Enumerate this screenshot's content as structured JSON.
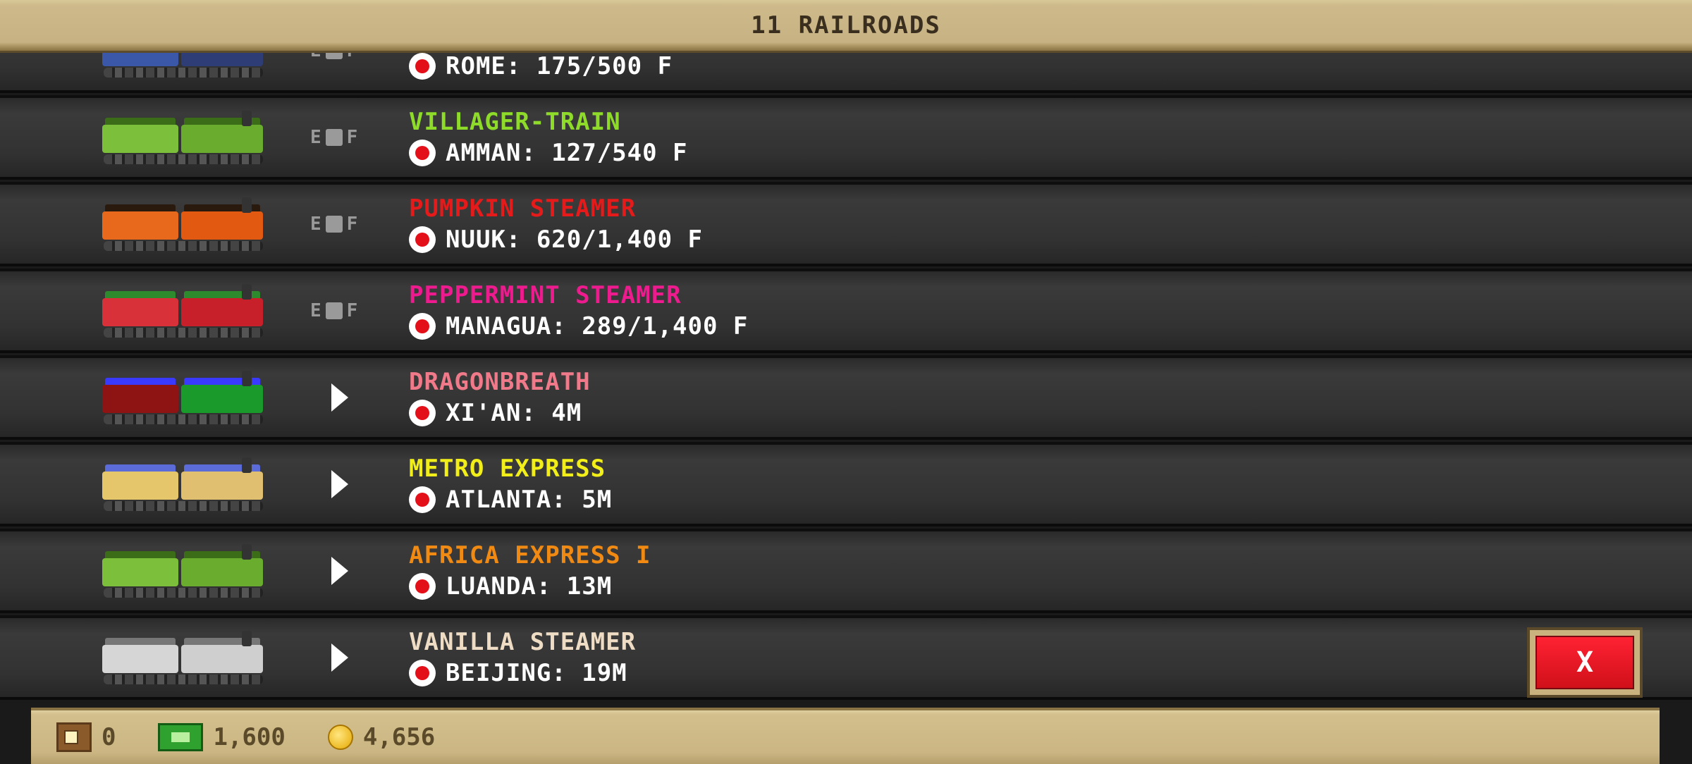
{
  "header": {
    "title": "11 RAILROADS"
  },
  "rows": [
    {
      "name": "",
      "name_color": "#ffffff",
      "detail": "ROME: 175/500 F",
      "control": "fuel",
      "train_colors": {
        "tender": "#3b57a8",
        "loco": "#2e3d75",
        "roof": "#1e2a55"
      }
    },
    {
      "name": "VILLAGER-TRAIN",
      "name_color": "#8edb2a",
      "detail": "AMMAN: 127/540 F",
      "control": "fuel",
      "train_colors": {
        "tender": "#7cbf3a",
        "loco": "#6aad2e",
        "roof": "#3b6d18"
      }
    },
    {
      "name": "PUMPKIN STEAMER",
      "name_color": "#e51a1a",
      "detail": "NUUK: 620/1,400 F",
      "control": "fuel",
      "train_colors": {
        "tender": "#e8691b",
        "loco": "#e25a12",
        "roof": "#2a1a0e"
      }
    },
    {
      "name": "PEPPERMINT STEAMER",
      "name_color": "#ee1b8e",
      "detail": "MANAGUA: 289/1,400 F",
      "control": "fuel",
      "train_colors": {
        "tender": "#d8313a",
        "loco": "#c8202a",
        "roof": "#2d8a2d"
      }
    },
    {
      "name": "DRAGONBREATH",
      "name_color": "#f07a8a",
      "detail": "XI'AN: 4M",
      "control": "play",
      "train_colors": {
        "tender": "#8e1414",
        "loco": "#1a9a2a",
        "roof": "#3a3aff"
      }
    },
    {
      "name": "METRO EXPRESS",
      "name_color": "#f2ee1a",
      "detail": "ATLANTA: 5M",
      "control": "play",
      "train_colors": {
        "tender": "#e6c66a",
        "loco": "#e0c070",
        "roof": "#5b6bd8"
      }
    },
    {
      "name": "AFRICA EXPRESS I",
      "name_color": "#f08a12",
      "detail": "LUANDA: 13M",
      "control": "play",
      "train_colors": {
        "tender": "#7cbf3a",
        "loco": "#6aad2e",
        "roof": "#3b6d18"
      }
    },
    {
      "name": "VANILLA STEAMER",
      "name_color": "#efdcc4",
      "detail": "BEIJING: 19M",
      "control": "play",
      "train_colors": {
        "tender": "#d6d6d6",
        "loco": "#cfcfcf",
        "roof": "#777777"
      }
    }
  ],
  "fuel_label": "E F",
  "close_button": {
    "label": "X"
  },
  "footer": {
    "tickets": "0",
    "cash": "1,600",
    "coins": "4,656"
  }
}
